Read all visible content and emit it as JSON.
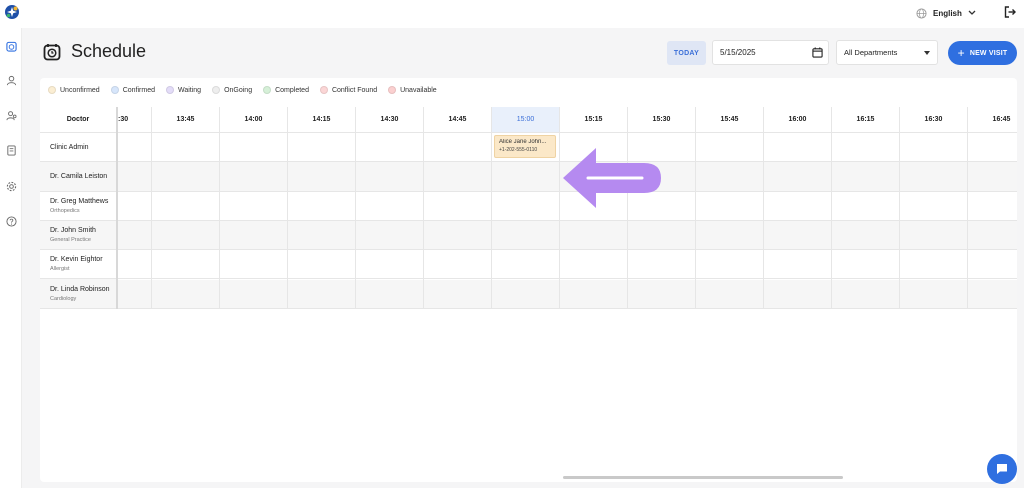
{
  "topbar": {
    "language": "English"
  },
  "header": {
    "title": "Schedule"
  },
  "toolbar": {
    "today_label": "TODAY",
    "date_value": "5/15/2025",
    "department_value": "All Departments",
    "new_visit_label": "NEW VISIT"
  },
  "legend": [
    {
      "label": "Unconfirmed",
      "color": "#fbeed3"
    },
    {
      "label": "Confirmed",
      "color": "#d7e6fb"
    },
    {
      "label": "Waiting",
      "color": "#e3dcf8"
    },
    {
      "label": "OnGoing",
      "color": "#eeeeee"
    },
    {
      "label": "Completed",
      "color": "#d6f0d8"
    },
    {
      "label": "Conflict Found",
      "color": "#fbd6d6"
    },
    {
      "label": "Unavailable",
      "color": "#fbd0d0"
    }
  ],
  "grid": {
    "doctor_header": "Doctor",
    "times": [
      ":30",
      "13:45",
      "14:00",
      "14:15",
      "14:30",
      "14:45",
      "15:00",
      "15:15",
      "15:30",
      "15:45",
      "16:00",
      "16:15",
      "16:30",
      "16:45"
    ],
    "current_time": "15:00",
    "doctors": [
      {
        "name": "Clinic Admin",
        "specialty": ""
      },
      {
        "name": "Dr. Camila Leiston",
        "specialty": ""
      },
      {
        "name": "Dr. Greg Matthews",
        "specialty": "Orthopedics"
      },
      {
        "name": "Dr. John Smith",
        "specialty": "General Practice"
      },
      {
        "name": "Dr. Kevin Eightor",
        "specialty": "Allergist"
      },
      {
        "name": "Dr. Linda Robinson",
        "specialty": "Cardiology"
      }
    ]
  },
  "appointment": {
    "patient": "Alice Jane John...",
    "phone": "+1-202-555-0110"
  },
  "colors": {
    "accent": "#2f6fe0",
    "arrow": "#b58af0"
  }
}
